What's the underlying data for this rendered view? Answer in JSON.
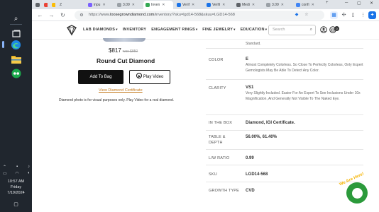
{
  "taskbar": {
    "time": "10:57 AM",
    "day": "Friday",
    "date": "7/19/2024"
  },
  "browser": {
    "tabs": [
      {
        "label": "inpu",
        "color": "#7b61ff"
      },
      {
        "label": "3.09",
        "color": "#9aa0a6"
      },
      {
        "label": "Inven",
        "color": "#34a853",
        "active": true
      },
      {
        "label": "Verif",
        "color": "#1a73e8"
      },
      {
        "label": "Verifi",
        "color": "#1a73e8"
      },
      {
        "label": "Medi",
        "color": "#5f6368"
      },
      {
        "label": "3.09",
        "color": "#9aa0a6"
      },
      {
        "label": "confi",
        "color": "#4285f4"
      }
    ],
    "url_prefix": "https://www.",
    "url_domain": "loosegrowndiamond.com",
    "url_path": "/inventory/?sku=lgd14-568&skuu=LGD14-568"
  },
  "site": {
    "nav": [
      {
        "label": "LAB DIAMONDS"
      },
      {
        "label": "INVENTORY"
      },
      {
        "label": "ENGAGEMENT RINGS"
      },
      {
        "label": "FINE JEWELRY"
      },
      {
        "label": "EDUCATION"
      }
    ],
    "search_placeholder": "Search",
    "cart_count": "0"
  },
  "product": {
    "price": "$817",
    "old_price": "was $850",
    "name": "Round Cut Diamond",
    "add_to_bag": "Add To Bag",
    "play_video": "Play Video",
    "cert_link": "View Diamond Certificate",
    "disclaimer": "Diamond photo is for visual purposes only. Play Video for a real diamond."
  },
  "specs": {
    "top_note": "Standard.",
    "color_label": "COLOR",
    "color_value": "E",
    "color_desc": "Almost Completely Colorless. So Close To Perfectly Colorless, Only Expert Gemologists May Be Able To Detect Any Color.",
    "clarity_label": "CLARITY",
    "clarity_value": "VS1",
    "clarity_desc": "Very Slightly Included. Easier For An Expert To See Inclusions Under 10x Magnification, And Generally Not Visible To The Naked Eye.",
    "box_label": "IN THE BOX",
    "box_value": "Diamond, IGI Certificate.",
    "table_label_1": "TABLE &",
    "table_label_2": "DEPTH",
    "table_value": "56.00%, 61.40%",
    "lw_label": "L/W RATIO",
    "lw_value": "0.99",
    "sku_label": "SKU",
    "sku_value": "LGD14-568",
    "growth_label": "GROWTH TYPE",
    "growth_value": "CVD"
  },
  "chat": {
    "tag": "We Are Here!"
  }
}
